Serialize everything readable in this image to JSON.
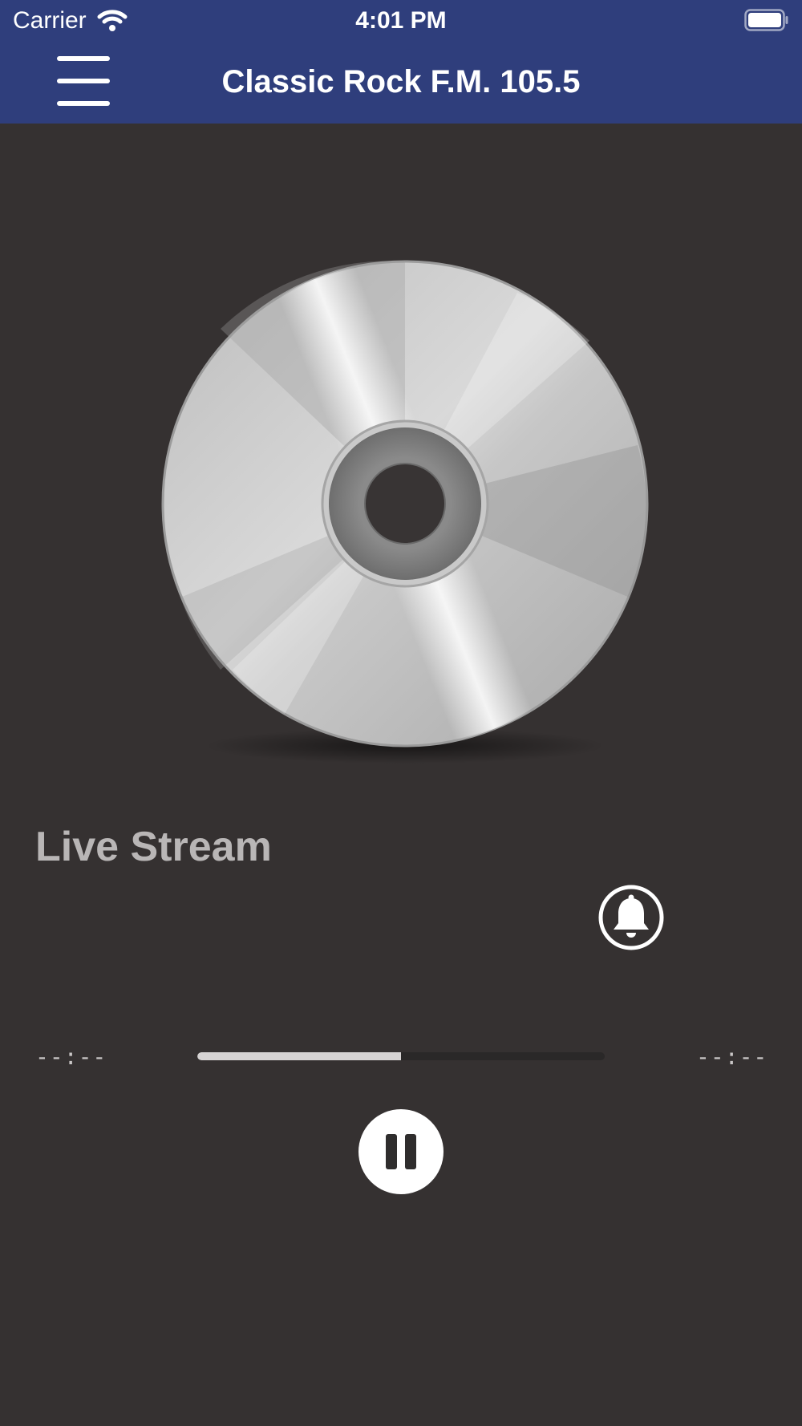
{
  "status_bar": {
    "carrier": "Carrier",
    "time": "4:01 PM"
  },
  "header": {
    "title": "Classic Rock F.M. 105.5",
    "menu_icon": "hamburger-menu-icon",
    "background_color": "#2f3e7c"
  },
  "artwork": {
    "icon": "compact-disc-icon"
  },
  "player": {
    "section_title": "Live Stream",
    "elapsed": "--:--",
    "remaining": "--:--",
    "buffer_progress": 0.5,
    "bell_icon": "notification-bell-icon",
    "pause_icon": "pause-icon"
  },
  "colors": {
    "background": "#353131",
    "accent": "#2f3e7c"
  }
}
